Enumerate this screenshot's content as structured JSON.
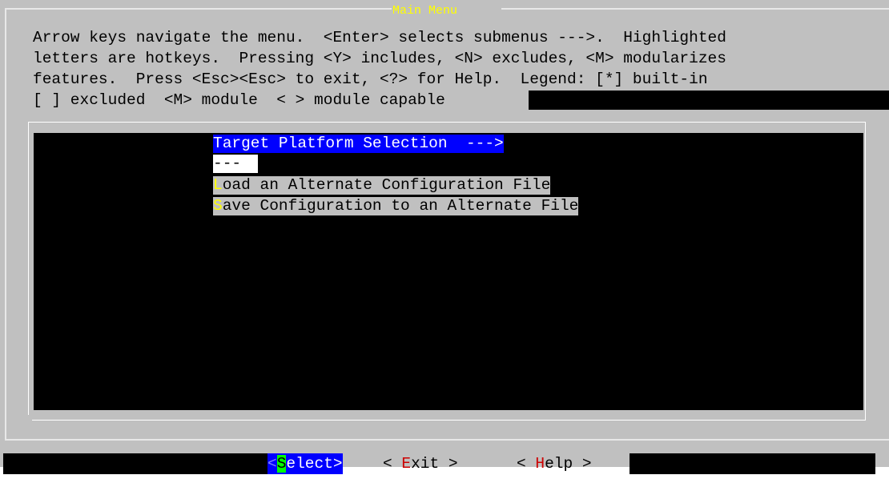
{
  "dialog": {
    "title": "Main Menu",
    "help_lines": [
      "Arrow keys navigate the menu.  <Enter> selects submenus --->.  Highlighted",
      "letters are hotkeys.  Pressing <Y> includes, <N> excludes, <M> modularizes",
      "features.  Press <Esc><Esc> to exit, <?> for Help.  Legend: [*] built-in",
      "[ ] excluded  <M> module  < > module capable"
    ]
  },
  "menu": {
    "items": [
      {
        "label": "Target Platform Selection  --->",
        "selected": true
      },
      {
        "label": "---",
        "separator": true
      },
      {
        "hotkey": "L",
        "rest": "oad an Alternate Configuration File"
      },
      {
        "hotkey": "S",
        "rest": "ave Configuration to an Alternate File"
      }
    ]
  },
  "buttons": {
    "select": {
      "lt": "<",
      "hotkey": "S",
      "rest": "elect",
      "gt": ">"
    },
    "exit": {
      "lt": "< ",
      "hotkey": "E",
      "rest": "xit",
      "gt": " >"
    },
    "help": {
      "lt": "< ",
      "hotkey": "H",
      "rest": "elp",
      "gt": " >"
    }
  },
  "colors": {
    "title": "#ffff00",
    "selected_bg": "#0000ff",
    "hotkey_green": "#00ff00",
    "hotkey_red": "#cc0000",
    "dialog_bg": "#c0c0c0"
  }
}
